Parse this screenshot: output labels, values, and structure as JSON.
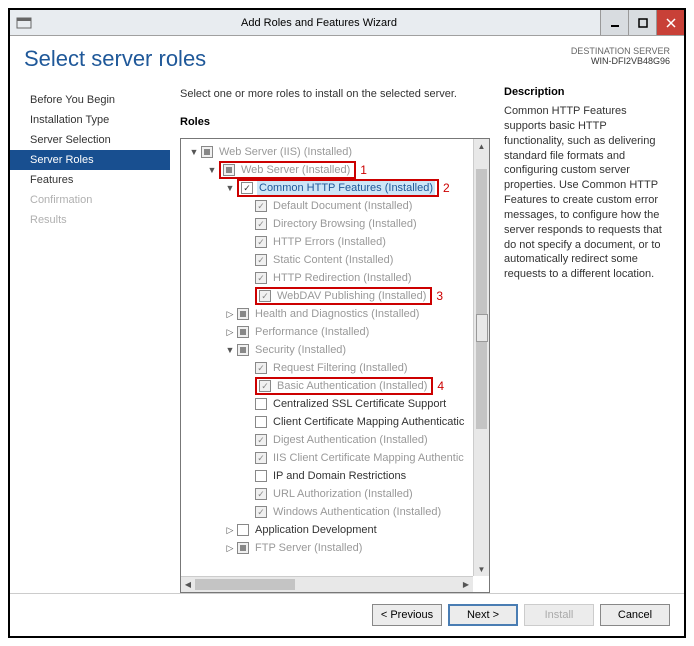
{
  "window": {
    "title": "Add Roles and Features Wizard"
  },
  "header": {
    "page_title": "Select server roles",
    "dest_label": "DESTINATION SERVER",
    "dest_server": "WIN-DFI2VB48G96"
  },
  "sidebar": {
    "items": [
      {
        "label": "Before You Begin",
        "state": "normal"
      },
      {
        "label": "Installation Type",
        "state": "normal"
      },
      {
        "label": "Server Selection",
        "state": "normal"
      },
      {
        "label": "Server Roles",
        "state": "active"
      },
      {
        "label": "Features",
        "state": "normal"
      },
      {
        "label": "Confirmation",
        "state": "disabled"
      },
      {
        "label": "Results",
        "state": "disabled"
      }
    ]
  },
  "content": {
    "instruction": "Select one or more roles to install on the selected server.",
    "roles_label": "Roles",
    "tree": [
      {
        "indent": 0,
        "exp": "▼",
        "check": "tri",
        "style": "disabled",
        "label": "Web Server (IIS) (Installed)"
      },
      {
        "indent": 1,
        "exp": "▼",
        "check": "tri",
        "style": "disabled",
        "label": "Web Server (Installed)",
        "red": true,
        "anno": "1"
      },
      {
        "indent": 2,
        "exp": "▼",
        "check": "checked",
        "style": "enabled",
        "label": "Common HTTP Features (Installed)",
        "selected": true,
        "red": true,
        "anno": "2"
      },
      {
        "indent": 3,
        "exp": "",
        "check": "checked",
        "style": "disabled",
        "label": "Default Document (Installed)"
      },
      {
        "indent": 3,
        "exp": "",
        "check": "checked",
        "style": "disabled",
        "label": "Directory Browsing (Installed)"
      },
      {
        "indent": 3,
        "exp": "",
        "check": "checked",
        "style": "disabled",
        "label": "HTTP Errors (Installed)"
      },
      {
        "indent": 3,
        "exp": "",
        "check": "checked",
        "style": "disabled",
        "label": "Static Content (Installed)"
      },
      {
        "indent": 3,
        "exp": "",
        "check": "checked",
        "style": "disabled",
        "label": "HTTP Redirection (Installed)"
      },
      {
        "indent": 3,
        "exp": "",
        "check": "checked",
        "style": "disabled",
        "label": "WebDAV Publishing (Installed)",
        "red": true,
        "anno": "3"
      },
      {
        "indent": 2,
        "exp": "▷",
        "check": "tri",
        "style": "disabled",
        "label": "Health and Diagnostics (Installed)"
      },
      {
        "indent": 2,
        "exp": "▷",
        "check": "tri",
        "style": "disabled",
        "label": "Performance (Installed)"
      },
      {
        "indent": 2,
        "exp": "▼",
        "check": "tri",
        "style": "disabled",
        "label": "Security (Installed)"
      },
      {
        "indent": 3,
        "exp": "",
        "check": "checked",
        "style": "disabled",
        "label": "Request Filtering (Installed)"
      },
      {
        "indent": 3,
        "exp": "",
        "check": "checked",
        "style": "disabled",
        "label": "Basic Authentication (Installed)",
        "red": true,
        "anno": "4"
      },
      {
        "indent": 3,
        "exp": "",
        "check": "empty",
        "style": "enabled",
        "label": "Centralized SSL Certificate Support"
      },
      {
        "indent": 3,
        "exp": "",
        "check": "empty",
        "style": "enabled",
        "label": "Client Certificate Mapping Authenticatic"
      },
      {
        "indent": 3,
        "exp": "",
        "check": "checked",
        "style": "disabled",
        "label": "Digest Authentication (Installed)"
      },
      {
        "indent": 3,
        "exp": "",
        "check": "checked",
        "style": "disabled",
        "label": "IIS Client Certificate Mapping Authentic"
      },
      {
        "indent": 3,
        "exp": "",
        "check": "empty",
        "style": "enabled",
        "label": "IP and Domain Restrictions"
      },
      {
        "indent": 3,
        "exp": "",
        "check": "checked",
        "style": "disabled",
        "label": "URL Authorization (Installed)"
      },
      {
        "indent": 3,
        "exp": "",
        "check": "checked",
        "style": "disabled",
        "label": "Windows Authentication (Installed)"
      },
      {
        "indent": 2,
        "exp": "▷",
        "check": "empty",
        "style": "enabled",
        "label": "Application Development"
      },
      {
        "indent": 2,
        "exp": "▷",
        "check": "tri",
        "style": "disabled",
        "label": "FTP Server (Installed)"
      }
    ]
  },
  "description": {
    "title": "Description",
    "text": "Common HTTP Features supports basic HTTP functionality, such as delivering standard file formats and configuring custom server properties. Use Common HTTP Features to create custom error messages, to configure how the server responds to requests that do not specify a document, or to automatically redirect some requests to a different location."
  },
  "footer": {
    "previous": "< Previous",
    "next": "Next >",
    "install": "Install",
    "cancel": "Cancel"
  }
}
